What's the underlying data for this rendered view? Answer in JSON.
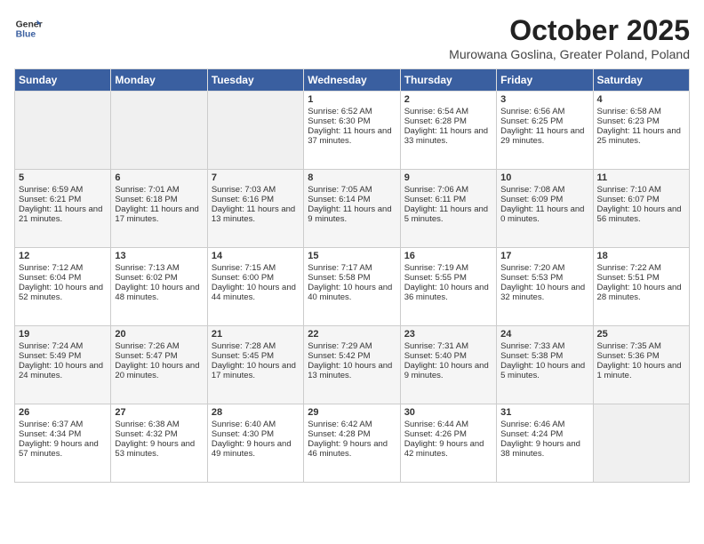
{
  "header": {
    "logo_line1": "General",
    "logo_line2": "Blue",
    "month": "October 2025",
    "location": "Murowana Goslina, Greater Poland, Poland"
  },
  "weekdays": [
    "Sunday",
    "Monday",
    "Tuesday",
    "Wednesday",
    "Thursday",
    "Friday",
    "Saturday"
  ],
  "weeks": [
    [
      {
        "day": "",
        "content": ""
      },
      {
        "day": "",
        "content": ""
      },
      {
        "day": "",
        "content": ""
      },
      {
        "day": "1",
        "content": "Sunrise: 6:52 AM\nSunset: 6:30 PM\nDaylight: 11 hours and 37 minutes."
      },
      {
        "day": "2",
        "content": "Sunrise: 6:54 AM\nSunset: 6:28 PM\nDaylight: 11 hours and 33 minutes."
      },
      {
        "day": "3",
        "content": "Sunrise: 6:56 AM\nSunset: 6:25 PM\nDaylight: 11 hours and 29 minutes."
      },
      {
        "day": "4",
        "content": "Sunrise: 6:58 AM\nSunset: 6:23 PM\nDaylight: 11 hours and 25 minutes."
      }
    ],
    [
      {
        "day": "5",
        "content": "Sunrise: 6:59 AM\nSunset: 6:21 PM\nDaylight: 11 hours and 21 minutes."
      },
      {
        "day": "6",
        "content": "Sunrise: 7:01 AM\nSunset: 6:18 PM\nDaylight: 11 hours and 17 minutes."
      },
      {
        "day": "7",
        "content": "Sunrise: 7:03 AM\nSunset: 6:16 PM\nDaylight: 11 hours and 13 minutes."
      },
      {
        "day": "8",
        "content": "Sunrise: 7:05 AM\nSunset: 6:14 PM\nDaylight: 11 hours and 9 minutes."
      },
      {
        "day": "9",
        "content": "Sunrise: 7:06 AM\nSunset: 6:11 PM\nDaylight: 11 hours and 5 minutes."
      },
      {
        "day": "10",
        "content": "Sunrise: 7:08 AM\nSunset: 6:09 PM\nDaylight: 11 hours and 0 minutes."
      },
      {
        "day": "11",
        "content": "Sunrise: 7:10 AM\nSunset: 6:07 PM\nDaylight: 10 hours and 56 minutes."
      }
    ],
    [
      {
        "day": "12",
        "content": "Sunrise: 7:12 AM\nSunset: 6:04 PM\nDaylight: 10 hours and 52 minutes."
      },
      {
        "day": "13",
        "content": "Sunrise: 7:13 AM\nSunset: 6:02 PM\nDaylight: 10 hours and 48 minutes."
      },
      {
        "day": "14",
        "content": "Sunrise: 7:15 AM\nSunset: 6:00 PM\nDaylight: 10 hours and 44 minutes."
      },
      {
        "day": "15",
        "content": "Sunrise: 7:17 AM\nSunset: 5:58 PM\nDaylight: 10 hours and 40 minutes."
      },
      {
        "day": "16",
        "content": "Sunrise: 7:19 AM\nSunset: 5:55 PM\nDaylight: 10 hours and 36 minutes."
      },
      {
        "day": "17",
        "content": "Sunrise: 7:20 AM\nSunset: 5:53 PM\nDaylight: 10 hours and 32 minutes."
      },
      {
        "day": "18",
        "content": "Sunrise: 7:22 AM\nSunset: 5:51 PM\nDaylight: 10 hours and 28 minutes."
      }
    ],
    [
      {
        "day": "19",
        "content": "Sunrise: 7:24 AM\nSunset: 5:49 PM\nDaylight: 10 hours and 24 minutes."
      },
      {
        "day": "20",
        "content": "Sunrise: 7:26 AM\nSunset: 5:47 PM\nDaylight: 10 hours and 20 minutes."
      },
      {
        "day": "21",
        "content": "Sunrise: 7:28 AM\nSunset: 5:45 PM\nDaylight: 10 hours and 17 minutes."
      },
      {
        "day": "22",
        "content": "Sunrise: 7:29 AM\nSunset: 5:42 PM\nDaylight: 10 hours and 13 minutes."
      },
      {
        "day": "23",
        "content": "Sunrise: 7:31 AM\nSunset: 5:40 PM\nDaylight: 10 hours and 9 minutes."
      },
      {
        "day": "24",
        "content": "Sunrise: 7:33 AM\nSunset: 5:38 PM\nDaylight: 10 hours and 5 minutes."
      },
      {
        "day": "25",
        "content": "Sunrise: 7:35 AM\nSunset: 5:36 PM\nDaylight: 10 hours and 1 minute."
      }
    ],
    [
      {
        "day": "26",
        "content": "Sunrise: 6:37 AM\nSunset: 4:34 PM\nDaylight: 9 hours and 57 minutes."
      },
      {
        "day": "27",
        "content": "Sunrise: 6:38 AM\nSunset: 4:32 PM\nDaylight: 9 hours and 53 minutes."
      },
      {
        "day": "28",
        "content": "Sunrise: 6:40 AM\nSunset: 4:30 PM\nDaylight: 9 hours and 49 minutes."
      },
      {
        "day": "29",
        "content": "Sunrise: 6:42 AM\nSunset: 4:28 PM\nDaylight: 9 hours and 46 minutes."
      },
      {
        "day": "30",
        "content": "Sunrise: 6:44 AM\nSunset: 4:26 PM\nDaylight: 9 hours and 42 minutes."
      },
      {
        "day": "31",
        "content": "Sunrise: 6:46 AM\nSunset: 4:24 PM\nDaylight: 9 hours and 38 minutes."
      },
      {
        "day": "",
        "content": ""
      }
    ]
  ]
}
